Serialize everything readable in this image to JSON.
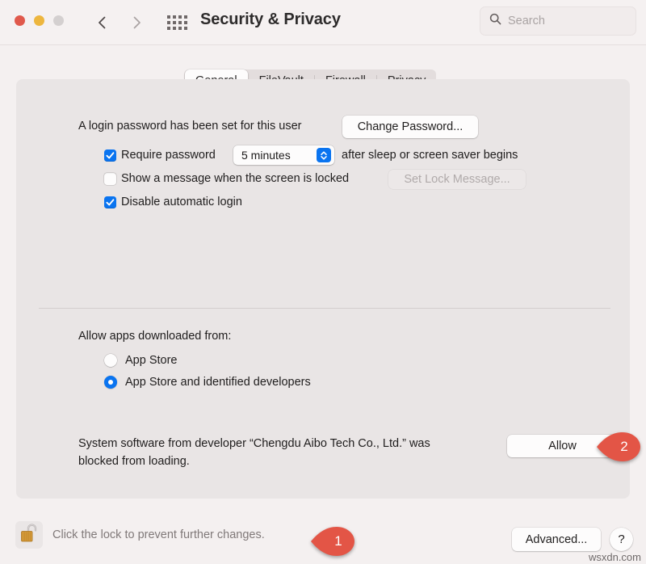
{
  "window": {
    "title": "Security & Privacy",
    "traffic_lights": [
      "close",
      "minimize",
      "zoom"
    ]
  },
  "toolbar": {
    "back_icon": "chevron-left-icon",
    "forward_icon": "chevron-right-icon",
    "grid_icon": "show-all-grid-icon",
    "search": {
      "icon": "search-icon",
      "placeholder": "Search",
      "value": ""
    }
  },
  "tabs": [
    {
      "label": "General",
      "active": true
    },
    {
      "label": "FileVault",
      "active": false
    },
    {
      "label": "Firewall",
      "active": false
    },
    {
      "label": "Privacy",
      "active": false
    }
  ],
  "general": {
    "login_password_text": "A login password has been set for this user",
    "change_password_button": "Change Password...",
    "require_password": {
      "checked": true,
      "label_before": "Require password",
      "select_value": "5 minutes",
      "label_after": "after sleep or screen saver begins"
    },
    "show_message": {
      "checked": false,
      "label": "Show a message when the screen is locked",
      "button": "Set Lock Message...",
      "button_disabled": true
    },
    "disable_automatic_login": {
      "checked": true,
      "label": "Disable automatic login"
    },
    "allow_apps_heading": "Allow apps downloaded from:",
    "allow_apps_options": [
      {
        "label": "App Store",
        "selected": false
      },
      {
        "label": "App Store and identified developers",
        "selected": true
      }
    ],
    "blocked_notice_line1": "System software from developer “Chengdu Aibo Tech Co., Ltd.” was",
    "blocked_notice_line2": "blocked from loading.",
    "allow_button": "Allow"
  },
  "bottom": {
    "lock_icon": "unlocked-padlock-icon",
    "lock_note": "Click the lock to prevent further changes.",
    "advanced_button": "Advanced...",
    "help_button": "?",
    "watermark": "wsxdn.com"
  },
  "markers": [
    {
      "number": "1",
      "target": "lock-button"
    },
    {
      "number": "2",
      "target": "allow-button"
    }
  ],
  "colors": {
    "accent_blue": "#0a74f0",
    "marker_red": "#e35546",
    "window_bg": "#f4f0f0",
    "panel_bg": "#e9e5e5"
  }
}
